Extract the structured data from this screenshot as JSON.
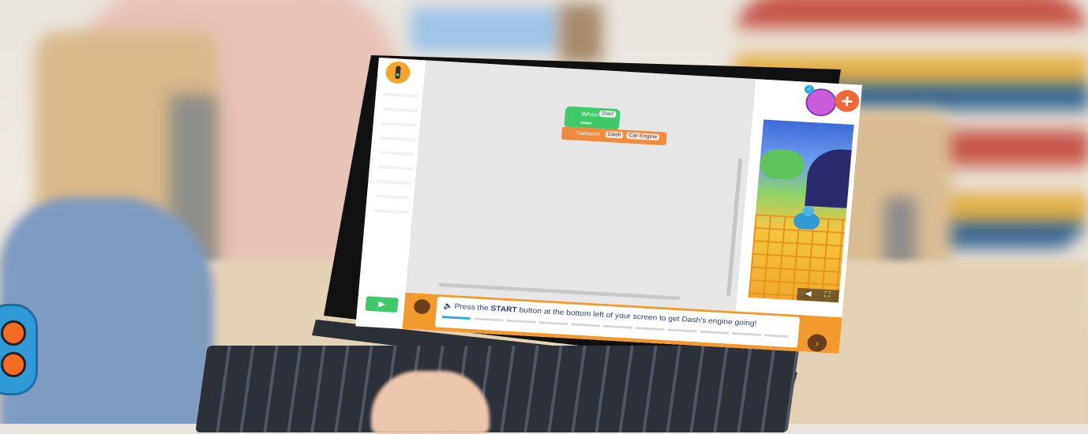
{
  "scene": {
    "colors": {
      "bezel": "#111111",
      "keyboard": "#4e5663",
      "accent_orange": "#f39a2c",
      "accent_green": "#3fc96a",
      "accent_blue": "#2aa8e6"
    }
  },
  "app": {
    "logo_icon": "traffic-light-icon",
    "workspace": {
      "blocks": {
        "when": {
          "label": "When",
          "trigger": "Start"
        },
        "transport": {
          "label": "Transport",
          "target": "Dash",
          "option": "Car Engine"
        }
      },
      "controls": {
        "undo_icon": "undo-icon",
        "redo_icon": "redo-icon",
        "reset_icon": "refresh-icon"
      }
    },
    "simulator": {
      "add_label": "+",
      "sound_icon": "speaker-icon",
      "fullscreen_icon": "fullscreen-icon"
    },
    "bottom_bar": {
      "play_label": "▶",
      "tip": {
        "prefix": "Press the ",
        "emphasis": "START",
        "suffix": " button at the bottom left of your screen to get Dash's engine going!",
        "progress_fraction": 0.08
      },
      "next_label": "›"
    }
  }
}
